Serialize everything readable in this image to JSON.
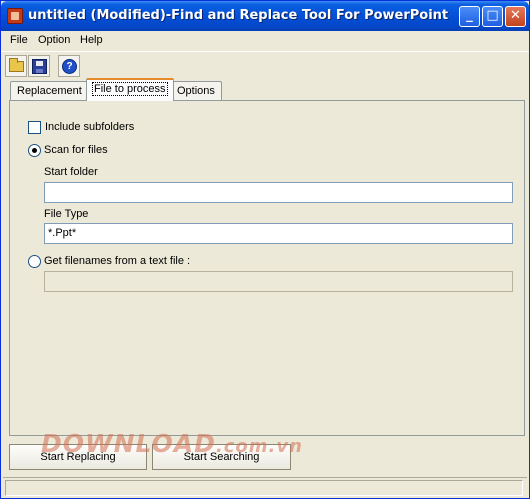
{
  "window": {
    "title": "untitled (Modified)-Find and Replace Tool For PowerPoint",
    "minimize": "_",
    "maximize": "□",
    "close": "✕"
  },
  "menu": [
    "File",
    "Option",
    "Help"
  ],
  "toolbar": {
    "open_icon": "open-folder-icon",
    "save_icon": "save-disk-icon",
    "help_icon": "help-icon",
    "help_glyph": "?"
  },
  "tabs": [
    "Replacement",
    "File to process",
    "Options"
  ],
  "active_tab": "File to process",
  "panel": {
    "include_subfolders_label": "Include subfolders",
    "include_subfolders_checked": false,
    "scan_for_files_label": "Scan for files",
    "scan_for_files_selected": true,
    "start_folder_label": "Start folder",
    "start_folder_value": "",
    "file_type_label": "File Type",
    "file_type_value": "*.Ppt*",
    "get_filenames_label": "Get filenames from a text file :",
    "get_filenames_selected": false,
    "text_file_value": ""
  },
  "buttons": {
    "start_replacing": "Start Replacing",
    "start_searching": "Start Searching"
  },
  "watermark": {
    "text": "DOWNLOAD",
    "suffix": ".com.vn"
  }
}
